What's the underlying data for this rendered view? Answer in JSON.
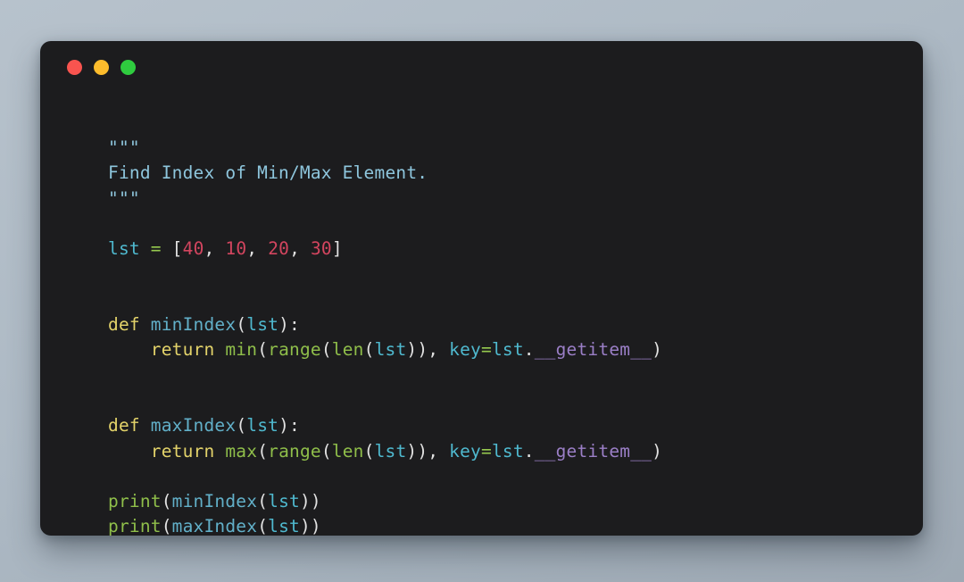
{
  "window": {
    "traffic_lights": [
      {
        "name": "close-button",
        "color": "#f9544f"
      },
      {
        "name": "minimize-button",
        "color": "#fdbc2c"
      },
      {
        "name": "maximize-button",
        "color": "#2fcc3f"
      }
    ],
    "background": "#1c1c1e",
    "page_background": "#adb9c4"
  },
  "code": {
    "language": "python",
    "lines": [
      [
        {
          "t": "\"\"\"",
          "c": "t-doc"
        }
      ],
      [
        {
          "t": "Find Index of Min/Max Element.",
          "c": "t-doc"
        }
      ],
      [
        {
          "t": "\"\"\"",
          "c": "t-doc"
        }
      ],
      [],
      [
        {
          "t": "lst",
          "c": "t-var"
        },
        {
          "t": " ",
          "c": "t-pun"
        },
        {
          "t": "=",
          "c": "t-op"
        },
        {
          "t": " [",
          "c": "t-pun"
        },
        {
          "t": "40",
          "c": "t-num"
        },
        {
          "t": ", ",
          "c": "t-pun"
        },
        {
          "t": "10",
          "c": "t-num"
        },
        {
          "t": ", ",
          "c": "t-pun"
        },
        {
          "t": "20",
          "c": "t-num"
        },
        {
          "t": ", ",
          "c": "t-pun"
        },
        {
          "t": "30",
          "c": "t-num"
        },
        {
          "t": "]",
          "c": "t-pun"
        }
      ],
      [],
      [],
      [
        {
          "t": "def",
          "c": "t-kw"
        },
        {
          "t": " ",
          "c": "t-pun"
        },
        {
          "t": "minIndex",
          "c": "t-fn"
        },
        {
          "t": "(",
          "c": "t-pun"
        },
        {
          "t": "lst",
          "c": "t-var"
        },
        {
          "t": "):",
          "c": "t-pun"
        }
      ],
      [
        {
          "t": "    ",
          "c": "t-pun"
        },
        {
          "t": "return",
          "c": "t-kw"
        },
        {
          "t": " ",
          "c": "t-pun"
        },
        {
          "t": "min",
          "c": "t-bi"
        },
        {
          "t": "(",
          "c": "t-pun"
        },
        {
          "t": "range",
          "c": "t-bi"
        },
        {
          "t": "(",
          "c": "t-pun"
        },
        {
          "t": "len",
          "c": "t-bi"
        },
        {
          "t": "(",
          "c": "t-pun"
        },
        {
          "t": "lst",
          "c": "t-var"
        },
        {
          "t": ")), ",
          "c": "t-pun"
        },
        {
          "t": "key",
          "c": "t-var"
        },
        {
          "t": "=",
          "c": "t-op"
        },
        {
          "t": "lst",
          "c": "t-var"
        },
        {
          "t": ".",
          "c": "t-pun"
        },
        {
          "t": "__getitem__",
          "c": "t-dun"
        },
        {
          "t": ")",
          "c": "t-pun"
        }
      ],
      [],
      [],
      [
        {
          "t": "def",
          "c": "t-kw"
        },
        {
          "t": " ",
          "c": "t-pun"
        },
        {
          "t": "maxIndex",
          "c": "t-fn"
        },
        {
          "t": "(",
          "c": "t-pun"
        },
        {
          "t": "lst",
          "c": "t-var"
        },
        {
          "t": "):",
          "c": "t-pun"
        }
      ],
      [
        {
          "t": "    ",
          "c": "t-pun"
        },
        {
          "t": "return",
          "c": "t-kw"
        },
        {
          "t": " ",
          "c": "t-pun"
        },
        {
          "t": "max",
          "c": "t-bi"
        },
        {
          "t": "(",
          "c": "t-pun"
        },
        {
          "t": "range",
          "c": "t-bi"
        },
        {
          "t": "(",
          "c": "t-pun"
        },
        {
          "t": "len",
          "c": "t-bi"
        },
        {
          "t": "(",
          "c": "t-pun"
        },
        {
          "t": "lst",
          "c": "t-var"
        },
        {
          "t": ")), ",
          "c": "t-pun"
        },
        {
          "t": "key",
          "c": "t-var"
        },
        {
          "t": "=",
          "c": "t-op"
        },
        {
          "t": "lst",
          "c": "t-var"
        },
        {
          "t": ".",
          "c": "t-pun"
        },
        {
          "t": "__getitem__",
          "c": "t-dun"
        },
        {
          "t": ")",
          "c": "t-pun"
        }
      ],
      [],
      [
        {
          "t": "print",
          "c": "t-bi"
        },
        {
          "t": "(",
          "c": "t-pun"
        },
        {
          "t": "minIndex",
          "c": "t-name"
        },
        {
          "t": "(",
          "c": "t-pun"
        },
        {
          "t": "lst",
          "c": "t-var"
        },
        {
          "t": "))",
          "c": "t-pun"
        }
      ],
      [
        {
          "t": "print",
          "c": "t-bi"
        },
        {
          "t": "(",
          "c": "t-pun"
        },
        {
          "t": "maxIndex",
          "c": "t-name"
        },
        {
          "t": "(",
          "c": "t-pun"
        },
        {
          "t": "lst",
          "c": "t-var"
        },
        {
          "t": "))",
          "c": "t-pun"
        }
      ]
    ]
  }
}
